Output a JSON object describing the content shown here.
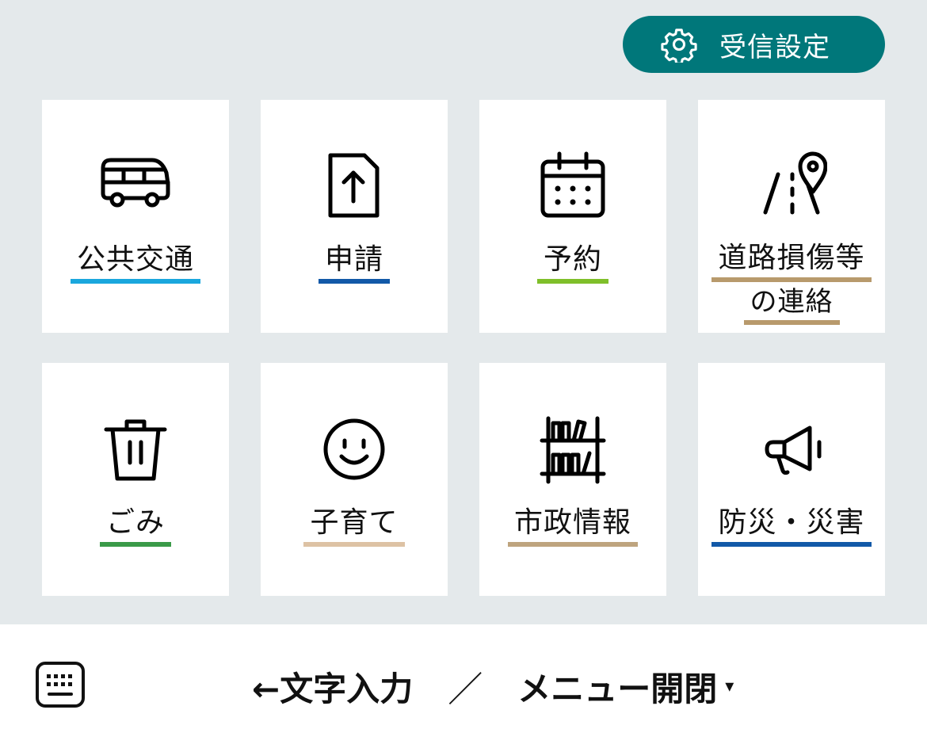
{
  "settings": {
    "label": "受信設定",
    "icon": "gear-icon",
    "bg_color": "#00777a"
  },
  "tiles": [
    {
      "label": "公共交通",
      "icon": "bus-icon",
      "underline_color": "#1aa7dd"
    },
    {
      "label": "申請",
      "icon": "upload-document-icon",
      "underline_color": "#1259a8"
    },
    {
      "label": "予約",
      "icon": "calendar-icon",
      "underline_color": "#7fbf2a"
    },
    {
      "label_line1": "道路損傷等",
      "label_line2": "の連絡",
      "icon": "road-location-pin-icon",
      "underline_color": "#b89a6c"
    },
    {
      "label": "ごみ",
      "icon": "trash-can-icon",
      "underline_color": "#3a9a48"
    },
    {
      "label": "子育て",
      "icon": "smiley-face-icon",
      "underline_color": "#ddc2a4"
    },
    {
      "label": "市政情報",
      "icon": "bookshelf-icon",
      "underline_color": "#bea47e"
    },
    {
      "label": "防災・災害",
      "icon": "megaphone-icon",
      "underline_color": "#1259a8"
    }
  ],
  "bottom_bar": {
    "keyboard_icon": "keyboard-icon",
    "text_input": "←文字入力",
    "separator": "／",
    "menu_toggle": "メニュー開閉",
    "caret": "▾"
  }
}
